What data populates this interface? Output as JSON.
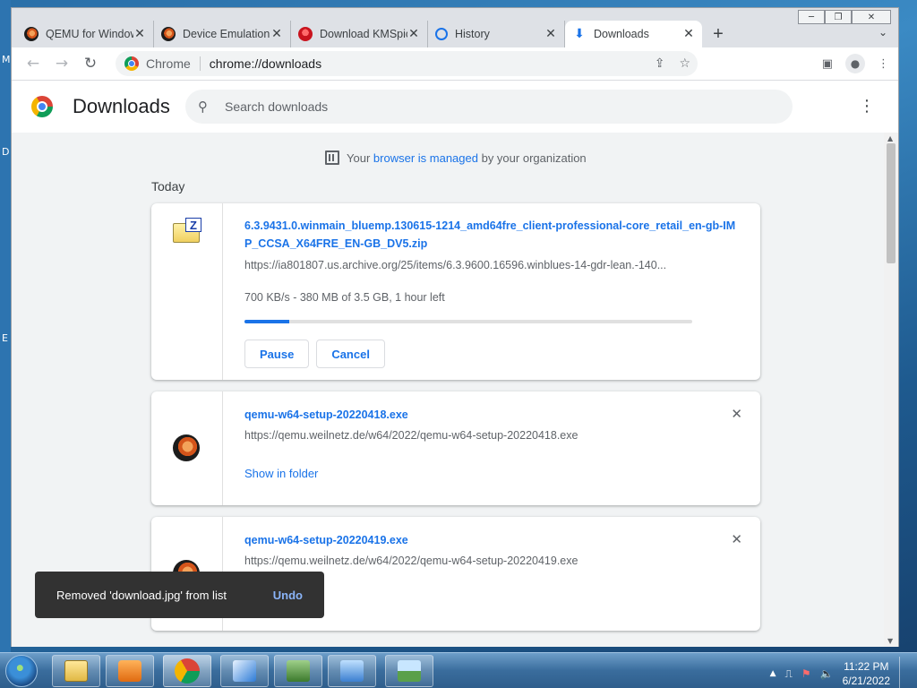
{
  "desktop": {
    "edge_letters": [
      "M",
      "D",
      "E"
    ]
  },
  "window": {
    "controls": [
      "minimize",
      "maximize",
      "close"
    ]
  },
  "tabs": [
    {
      "title": "QEMU for Windows",
      "icon": "qemu-icon"
    },
    {
      "title": "Device Emulation",
      "icon": "qemu-icon"
    },
    {
      "title": "Download KMSpico",
      "icon": "red-circle-icon"
    },
    {
      "title": "History",
      "icon": "history-icon"
    },
    {
      "title": "Downloads",
      "icon": "download-icon",
      "active": true
    }
  ],
  "toolbar": {
    "omnibox_label": "Chrome",
    "omnibox_url": "chrome://downloads"
  },
  "downloads_page": {
    "title": "Downloads",
    "search_placeholder": "Search downloads",
    "managed_prefix": "Your",
    "managed_link": "browser is managed",
    "managed_suffix": "by your organization",
    "section_label": "Today"
  },
  "items": [
    {
      "filename": "6.3.9431.0.winmain_bluemp.130615-1214_amd64fre_client-professional-core_retail_en-gb-IMP_CCSA_X64FRE_EN-GB_DV5.zip",
      "url": "https://ia801807.us.archive.org/25/items/6.3.9600.16596.winblues-14-gdr-lean.-140...",
      "status": "700 KB/s - 380 MB of 3.5 GB, 1 hour left",
      "progress": 0.1,
      "pause_label": "Pause",
      "cancel_label": "Cancel"
    },
    {
      "filename": "qemu-w64-setup-20220418.exe",
      "url": "https://qemu.weilnetz.de/w64/2022/qemu-w64-setup-20220418.exe",
      "action_label": "Show in folder"
    },
    {
      "filename": "qemu-w64-setup-20220419.exe",
      "url": "https://qemu.weilnetz.de/w64/2022/qemu-w64-setup-20220419.exe"
    }
  ],
  "toast": {
    "message": "Removed 'download.jpg' from list",
    "undo_label": "Undo"
  },
  "taskbar": {
    "time": "11:22 PM",
    "date": "6/21/2022"
  }
}
